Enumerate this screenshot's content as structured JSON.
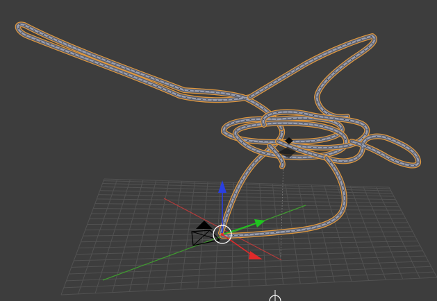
{
  "app": "3D viewport",
  "viewport": {
    "background_color": "#3d3d3d",
    "grid": {
      "line_color": "#525252",
      "x_axis_color": "#b33a3a",
      "y_axis_color": "#3f9a2f"
    },
    "objects": {
      "track_curve": {
        "selected": true,
        "outline_color": "#e0983e",
        "rail_color": "#9aa0b3"
      },
      "camera": {
        "color": "#000000"
      },
      "cursor_3d": {
        "color": "#ffffff"
      }
    },
    "manipulator": {
      "x_arrow_color": "#e02a2a",
      "y_arrow_color": "#1fc41f",
      "z_arrow_color": "#2a3fe0",
      "icons": [
        "x-arrow-icon",
        "y-arrow-icon",
        "z-arrow-icon"
      ]
    }
  }
}
